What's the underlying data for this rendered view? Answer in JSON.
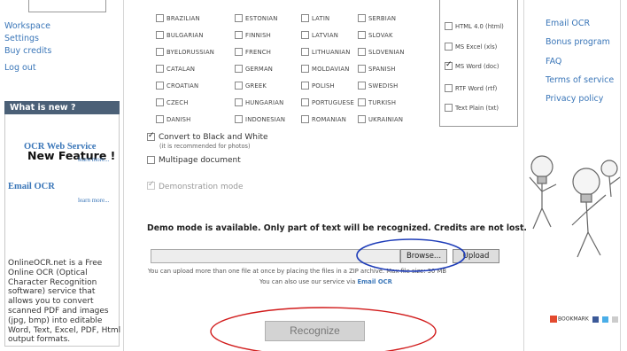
{
  "sidebar": {
    "links": [
      "Workspace",
      "Settings",
      "Buy credits",
      "Log out"
    ],
    "whats_new_title": "What is new ?",
    "new_feature_title": "New Feature !",
    "ocr_web_service": "OCR Web Service",
    "learn_more_1": "learn more...",
    "email_ocr": "Email OCR",
    "learn_more_2": "learn more...",
    "description": "OnlineOCR.net is a Free Online OCR (Optical Character Recognition software) service that allows you to convert scanned PDF and images (jpg, bmp) into editable Word, Text, Excel, PDF, Html output formats."
  },
  "languages": {
    "columns": [
      [
        "BRAZILIAN",
        "BULGARIAN",
        "BYELORUSSIAN",
        "CATALAN",
        "CROATIAN",
        "CZECH",
        "DANISH"
      ],
      [
        "ESTONIAN",
        "FINNISH",
        "FRENCH",
        "GERMAN",
        "GREEK",
        "HUNGARIAN",
        "INDONESIAN"
      ],
      [
        "LATIN",
        "LATVIAN",
        "LITHUANIAN",
        "MOLDAVIAN",
        "POLISH",
        "PORTUGUESE",
        "ROMANIAN"
      ],
      [
        "SERBIAN",
        "SLOVAK",
        "SLOVENIAN",
        "SPANISH",
        "SWEDISH",
        "TURKISH",
        "UKRAINIAN"
      ]
    ]
  },
  "formats": [
    {
      "label": "HTML 4.0 (html)",
      "checked": false
    },
    {
      "label": "MS Excel (xls)",
      "checked": false
    },
    {
      "label": "MS Word (doc)",
      "checked": true
    },
    {
      "label": "RTF Word (rtf)",
      "checked": false
    },
    {
      "label": "Text Plain (txt)",
      "checked": false
    }
  ],
  "right_links": [
    "Email OCR",
    "Bonus program",
    "FAQ",
    "Terms of service",
    "Privacy policy"
  ],
  "options": {
    "convert_bw": "Convert to Black and White",
    "convert_bw_note": "(it is recommended for photos)",
    "multipage": "Multipage document",
    "demo_mode": "Demonstration mode"
  },
  "demo_message": "Demo mode is available. Only part of text will be recognized. Credits are not lost.",
  "upload": {
    "browse_label": "Browse...",
    "upload_label": "Upload",
    "info_line": "You can upload more than one file at once by placing the files in a ZIP archive. Max file size: 30 MB",
    "info_line2_prefix": "You can also use our service via",
    "info_line2_link": "Email OCR"
  },
  "recognize_label": "Recognize",
  "bookmark_label": "BOOKMARK",
  "colors": {
    "link": "#3a76b8",
    "whats_new_bar": "#4b6077",
    "annotation_ellipse": "#d11a1a",
    "annotation_ellipse_browse": "#1d3cb8"
  }
}
